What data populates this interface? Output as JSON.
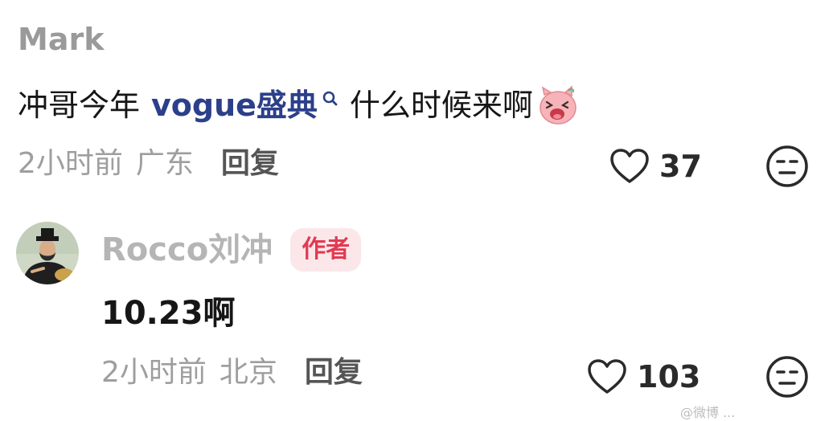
{
  "comment": {
    "username": "Mark",
    "text_before": "冲哥今年",
    "topic_link": "vogue盛典",
    "text_after": "什么时候来啊",
    "emoji_icon": "laughing-pig-emoji",
    "time": "2小时前",
    "location": "广东",
    "reply_label": "回复",
    "like_count": "37"
  },
  "reply": {
    "username": "Rocco刘冲",
    "badge": "作者",
    "text": "10.23啊",
    "time": "2小时前",
    "location": "北京",
    "reply_label": "回复",
    "like_count": "103"
  },
  "icons": {
    "like": "heart-outline-icon",
    "dislike": "expressionless-face-icon",
    "search_hint": "search-small-icon"
  },
  "colors": {
    "topic_link": "#2c3f8a",
    "badge_text": "#e23a52",
    "badge_bg": "#fbe7ea",
    "muted": "#9e9e9e"
  },
  "watermark": "@微博 ..."
}
